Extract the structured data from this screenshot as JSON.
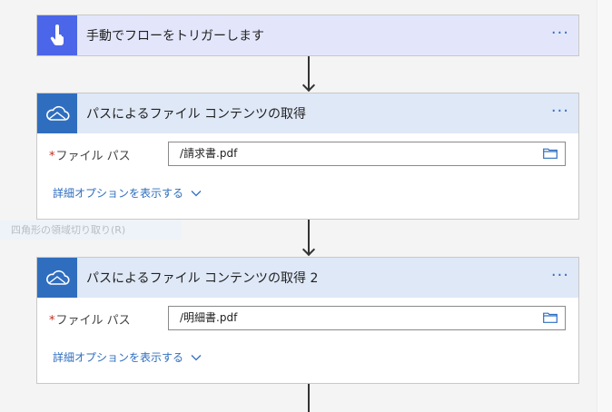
{
  "flow": {
    "trigger": {
      "title": "手動でフローをトリガーします",
      "icon": "touch-hand-icon",
      "more": "···"
    },
    "actions": [
      {
        "title": "パスによるファイル コンテンツの取得",
        "icon": "onedrive-cloud-icon",
        "more": "···",
        "field_label": "ファイル パス",
        "required_mark": "*",
        "field_value": "/請求書.pdf",
        "advanced_label": "詳細オプションを表示する"
      },
      {
        "title": "パスによるファイル コンテンツの取得 2",
        "icon": "onedrive-cloud-icon",
        "more": "···",
        "field_label": "ファイル パス",
        "required_mark": "*",
        "field_value": "/明細書.pdf",
        "advanced_label": "詳細オプションを表示する"
      }
    ]
  },
  "overlay_hint": "四角形の領域切り取り(R)",
  "colors": {
    "trigger_icon_bg": "#4b66e8",
    "trigger_header_bg": "#e3e6fb",
    "action_icon_bg": "#2f6ebf",
    "action_header_bg": "#dfe8f7",
    "link": "#2f6ebf",
    "required": "#c42b1c"
  }
}
